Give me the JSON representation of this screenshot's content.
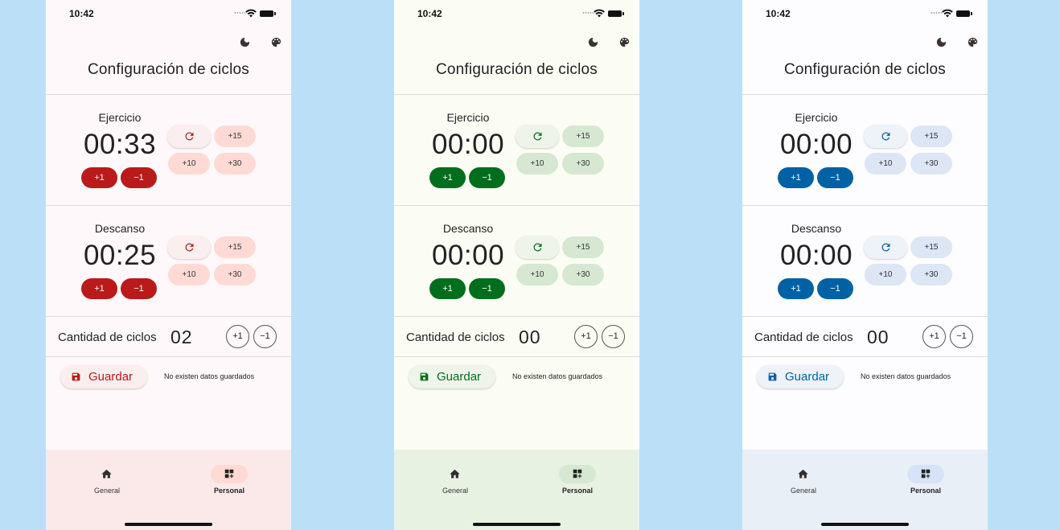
{
  "status_bar": {
    "time": "10:42"
  },
  "header": {
    "title": "Configuración de ciclos",
    "theme_icon": "moon-icon",
    "palette_icon": "palette-icon"
  },
  "exercise": {
    "label": "Ejercicio"
  },
  "rest": {
    "label": "Descanso"
  },
  "buttons": {
    "plus_one": "+1",
    "minus_one": "−1",
    "plus_fifteen": "+15",
    "plus_ten": "+10",
    "plus_thirty": "+30",
    "cycle_plus": "+1",
    "cycle_minus": "−1"
  },
  "cycles": {
    "label": "Cantidad de ciclos"
  },
  "save": {
    "label": "Guardar",
    "status": "No existen datos guardados"
  },
  "nav": {
    "general": "General",
    "personal": "Personal"
  },
  "themes": [
    {
      "name": "red",
      "exercise_time": "00:33",
      "rest_time": "00:25",
      "cycles_count": "02",
      "colors": {
        "bg": "#fff8fa",
        "accent": "#ba1a1a",
        "tonal": "#ffdad4",
        "reset_bg": "#fbeeee",
        "save_bg": "#fbeeee",
        "nav_bg": "#fbe9e9",
        "pill": "#ffdad4"
      }
    },
    {
      "name": "green",
      "exercise_time": "00:00",
      "rest_time": "00:00",
      "cycles_count": "00",
      "colors": {
        "bg": "#fbfdf4",
        "accent": "#006e1c",
        "tonal": "#d6e8d1",
        "reset_bg": "#eef4e9",
        "save_bg": "#eef4e9",
        "nav_bg": "#e8f2e3",
        "pill": "#d6e8d1"
      }
    },
    {
      "name": "blue",
      "exercise_time": "00:00",
      "rest_time": "00:00",
      "cycles_count": "00",
      "colors": {
        "bg": "#fdfcff",
        "accent": "#0061a4",
        "tonal": "#dce6f5",
        "reset_bg": "#eef2f9",
        "save_bg": "#eef2f9",
        "nav_bg": "#e9eff7",
        "pill": "#d6e3f7"
      }
    }
  ]
}
